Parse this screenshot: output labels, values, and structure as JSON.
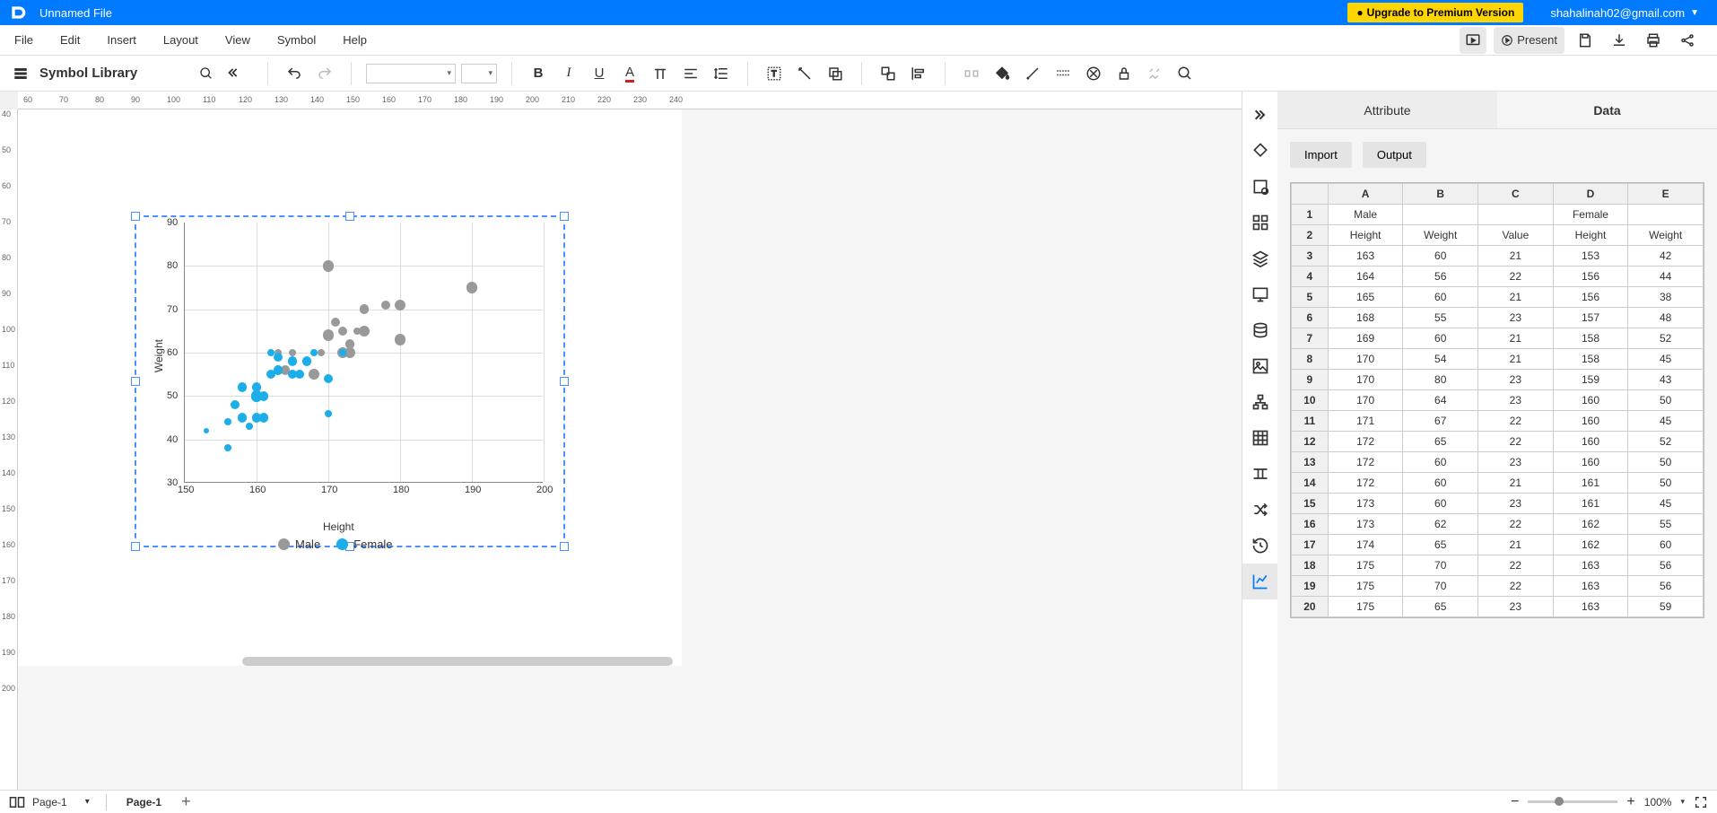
{
  "app": {
    "title": "Unnamed File",
    "upgrade": "Upgrade to Premium Version",
    "email": "shahalinah02@gmail.com"
  },
  "menus": [
    "File",
    "Edit",
    "Insert",
    "Layout",
    "View",
    "Symbol",
    "Help"
  ],
  "present": "Present",
  "symbolLibrary": "Symbol Library",
  "panel": {
    "tab_attribute": "Attribute",
    "tab_data": "Data",
    "btn_import": "Import",
    "btn_output": "Output",
    "cols": [
      "A",
      "B",
      "C",
      "D",
      "E"
    ],
    "rows": [
      [
        "1",
        "Male",
        "",
        "",
        "Female",
        ""
      ],
      [
        "2",
        "Height",
        "Weight",
        "Value",
        "Height",
        "Weight"
      ],
      [
        "3",
        "163",
        "60",
        "21",
        "153",
        "42"
      ],
      [
        "4",
        "164",
        "56",
        "22",
        "156",
        "44"
      ],
      [
        "5",
        "165",
        "60",
        "21",
        "156",
        "38"
      ],
      [
        "6",
        "168",
        "55",
        "23",
        "157",
        "48"
      ],
      [
        "7",
        "169",
        "60",
        "21",
        "158",
        "52"
      ],
      [
        "8",
        "170",
        "54",
        "21",
        "158",
        "45"
      ],
      [
        "9",
        "170",
        "80",
        "23",
        "159",
        "43"
      ],
      [
        "10",
        "170",
        "64",
        "23",
        "160",
        "50"
      ],
      [
        "11",
        "171",
        "67",
        "22",
        "160",
        "45"
      ],
      [
        "12",
        "172",
        "65",
        "22",
        "160",
        "52"
      ],
      [
        "13",
        "172",
        "60",
        "23",
        "160",
        "50"
      ],
      [
        "14",
        "172",
        "60",
        "21",
        "161",
        "50"
      ],
      [
        "15",
        "173",
        "60",
        "23",
        "161",
        "45"
      ],
      [
        "16",
        "173",
        "62",
        "22",
        "162",
        "55"
      ],
      [
        "17",
        "174",
        "65",
        "21",
        "162",
        "60"
      ],
      [
        "18",
        "175",
        "70",
        "22",
        "163",
        "56"
      ],
      [
        "19",
        "175",
        "70",
        "22",
        "163",
        "56"
      ],
      [
        "20",
        "175",
        "65",
        "23",
        "163",
        "59"
      ]
    ]
  },
  "status": {
    "page_sel": "Page-1",
    "page_tab": "Page-1",
    "zoom": "100%"
  },
  "chart_data": {
    "type": "scatter",
    "xlabel": "Height",
    "ylabel": "Weight",
    "x_ticks": [
      150,
      160,
      170,
      180,
      190,
      200
    ],
    "y_ticks": [
      30,
      40,
      50,
      60,
      70,
      80,
      90
    ],
    "xlim": [
      150,
      200
    ],
    "ylim": [
      30,
      90
    ],
    "legend": [
      "Male",
      "Female"
    ],
    "series": [
      {
        "name": "Male",
        "color": "#999",
        "points": [
          {
            "x": 163,
            "y": 60,
            "v": 21
          },
          {
            "x": 164,
            "y": 56,
            "v": 22
          },
          {
            "x": 165,
            "y": 60,
            "v": 21
          },
          {
            "x": 168,
            "y": 55,
            "v": 23
          },
          {
            "x": 169,
            "y": 60,
            "v": 21
          },
          {
            "x": 170,
            "y": 54,
            "v": 21
          },
          {
            "x": 170,
            "y": 80,
            "v": 23
          },
          {
            "x": 170,
            "y": 64,
            "v": 23
          },
          {
            "x": 171,
            "y": 67,
            "v": 22
          },
          {
            "x": 172,
            "y": 65,
            "v": 22
          },
          {
            "x": 172,
            "y": 60,
            "v": 23
          },
          {
            "x": 172,
            "y": 60,
            "v": 21
          },
          {
            "x": 173,
            "y": 60,
            "v": 23
          },
          {
            "x": 173,
            "y": 62,
            "v": 22
          },
          {
            "x": 174,
            "y": 65,
            "v": 21
          },
          {
            "x": 175,
            "y": 70,
            "v": 22
          },
          {
            "x": 175,
            "y": 70,
            "v": 22
          },
          {
            "x": 175,
            "y": 65,
            "v": 23
          },
          {
            "x": 178,
            "y": 71,
            "v": 22
          },
          {
            "x": 180,
            "y": 71,
            "v": 23
          },
          {
            "x": 180,
            "y": 63,
            "v": 23
          },
          {
            "x": 190,
            "y": 75,
            "v": 23
          }
        ]
      },
      {
        "name": "Female",
        "color": "#1caee8",
        "points": [
          {
            "x": 153,
            "y": 42,
            "v": 20
          },
          {
            "x": 156,
            "y": 44,
            "v": 21
          },
          {
            "x": 156,
            "y": 38,
            "v": 21
          },
          {
            "x": 157,
            "y": 48,
            "v": 22
          },
          {
            "x": 158,
            "y": 52,
            "v": 22
          },
          {
            "x": 158,
            "y": 45,
            "v": 22
          },
          {
            "x": 159,
            "y": 43,
            "v": 21
          },
          {
            "x": 160,
            "y": 50,
            "v": 23
          },
          {
            "x": 160,
            "y": 45,
            "v": 22
          },
          {
            "x": 160,
            "y": 52,
            "v": 22
          },
          {
            "x": 160,
            "y": 50,
            "v": 23
          },
          {
            "x": 161,
            "y": 50,
            "v": 22
          },
          {
            "x": 161,
            "y": 45,
            "v": 22
          },
          {
            "x": 162,
            "y": 55,
            "v": 22
          },
          {
            "x": 162,
            "y": 60,
            "v": 21
          },
          {
            "x": 163,
            "y": 56,
            "v": 22
          },
          {
            "x": 163,
            "y": 56,
            "v": 22
          },
          {
            "x": 163,
            "y": 59,
            "v": 22
          },
          {
            "x": 165,
            "y": 55,
            "v": 22
          },
          {
            "x": 165,
            "y": 58,
            "v": 22
          },
          {
            "x": 166,
            "y": 55,
            "v": 22
          },
          {
            "x": 167,
            "y": 58,
            "v": 22
          },
          {
            "x": 168,
            "y": 60,
            "v": 21
          },
          {
            "x": 170,
            "y": 54,
            "v": 22
          },
          {
            "x": 170,
            "y": 46,
            "v": 21
          },
          {
            "x": 172,
            "y": 60,
            "v": 21
          }
        ]
      }
    ]
  }
}
